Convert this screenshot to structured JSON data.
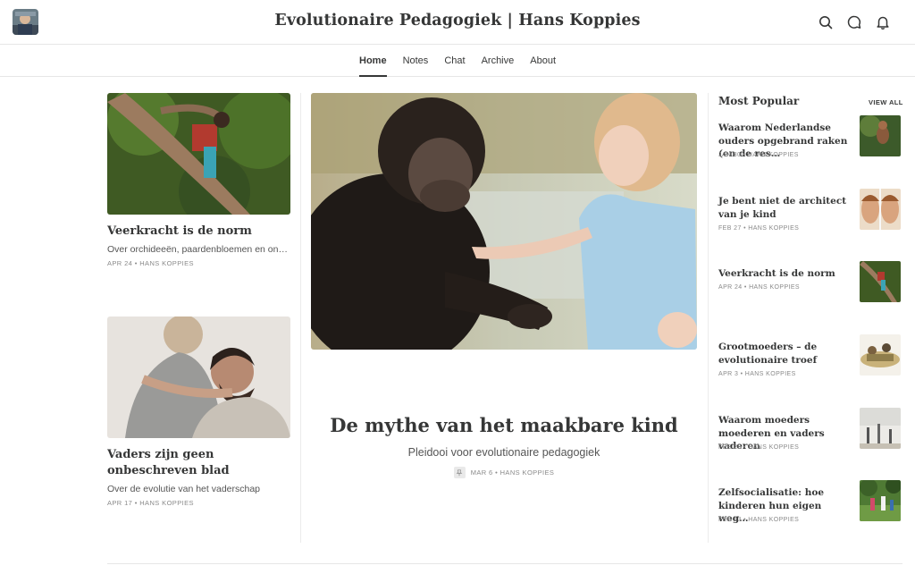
{
  "header": {
    "site_title": "Evolutionaire Pedagogiek | Hans Koppies",
    "icons": [
      "search-icon",
      "chat-icon",
      "bell-icon"
    ]
  },
  "nav": {
    "tabs": [
      {
        "label": "Home",
        "active": true
      },
      {
        "label": "Notes",
        "active": false
      },
      {
        "label": "Chat",
        "active": false
      },
      {
        "label": "Archive",
        "active": false
      },
      {
        "label": "About",
        "active": false
      }
    ]
  },
  "left_posts": [
    {
      "title": "Veerkracht is de norm",
      "subtitle": "Over orchideeën, paardenbloemen en onze…",
      "meta": "APR 24 • HANS KOPPIES"
    },
    {
      "title": "Vaders zijn geen onbeschreven blad",
      "subtitle": "Over de evolutie van het vaderschap",
      "meta": "APR 17 • HANS KOPPIES"
    }
  ],
  "featured": {
    "title": "De mythe van het maakbare kind",
    "subtitle": "Pleidooi voor evolutionaire pedagogiek",
    "meta": "MAR 6 • HANS KOPPIES",
    "pin_icon": "pin-icon"
  },
  "most_popular": {
    "heading": "Most Popular",
    "view_all": "VIEW ALL",
    "items": [
      {
        "title": "Waarom Nederlandse ouders opgebrand raken (en de res…",
        "meta": "JAN 30 • HANS KOPPIES"
      },
      {
        "title": "Je bent niet de architect van je kind",
        "meta": "FEB 27 • HANS KOPPIES"
      },
      {
        "title": "Veerkracht is de norm",
        "meta": "APR 24 • HANS KOPPIES"
      },
      {
        "title": "Grootmoeders – de evolutionaire troef",
        "meta": "APR 3 • HANS KOPPIES"
      },
      {
        "title": "Waarom moeders moederen en vaders vaderen",
        "meta": "FEB 20 • HANS KOPPIES"
      },
      {
        "title": "Zelfsocialisatie: hoe kinderen hun eigen weg…",
        "meta": "FEB 13 • HANS KOPPIES"
      }
    ]
  }
}
